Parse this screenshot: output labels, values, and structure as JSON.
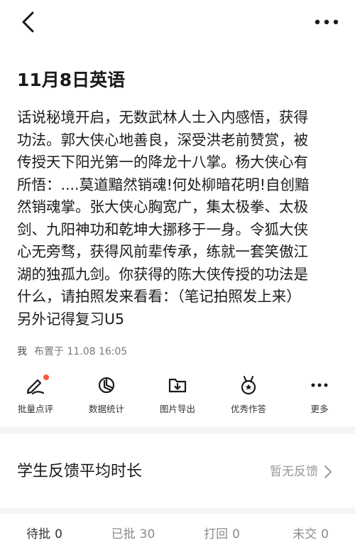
{
  "header": {
    "back_icon": "chevron-left-icon",
    "more_icon": "more-horizontal-icon"
  },
  "post": {
    "title": "11月8日英语",
    "body": "话说秘境开启，无数武林人士入内感悟，获得\n功法。郭大侠心地善良，深受洪老前赞赏，被\n传授天下阳光第一的降龙十八掌。杨大侠心有\n所悟：....莫道黯然销魂!何处柳暗花明!自创黯\n然销魂掌。张大侠心胸宽广，集太极拳、太极\n剑、九阳神功和乾坤大挪移于一身。令狐大侠\n心无旁骛，获得风前辈传承，练就一套笑傲江\n湖的独孤九剑。你获得的陈大侠传授的功法是\n什么，请拍照发来看看：（笔记拍照发上来）\n另外记得复习U5",
    "author": "我",
    "published": "布置于 11.08 16:05"
  },
  "toolbar": {
    "items": [
      {
        "label": "批量点评",
        "icon": "pen-icon",
        "badge": true
      },
      {
        "label": "数据统计",
        "icon": "pie-chart-icon"
      },
      {
        "label": "图片导出",
        "icon": "folder-download-icon"
      },
      {
        "label": "优秀作答",
        "icon": "medal-star-icon"
      },
      {
        "label": "更多",
        "icon": "more-horizontal-icon"
      }
    ]
  },
  "feedback": {
    "title": "学生反馈平均时长",
    "value": "暂无反馈",
    "chevron_icon": "chevron-right-icon"
  },
  "tabs": [
    {
      "label": "待批",
      "count": "0"
    },
    {
      "label": "已批",
      "count": "30"
    },
    {
      "label": "打回",
      "count": "0"
    },
    {
      "label": "未交",
      "count": "0"
    }
  ],
  "colors": {
    "badge": "#ff5a3c",
    "background": "#f4f4f6",
    "muted_text": "#9a9a9a"
  }
}
